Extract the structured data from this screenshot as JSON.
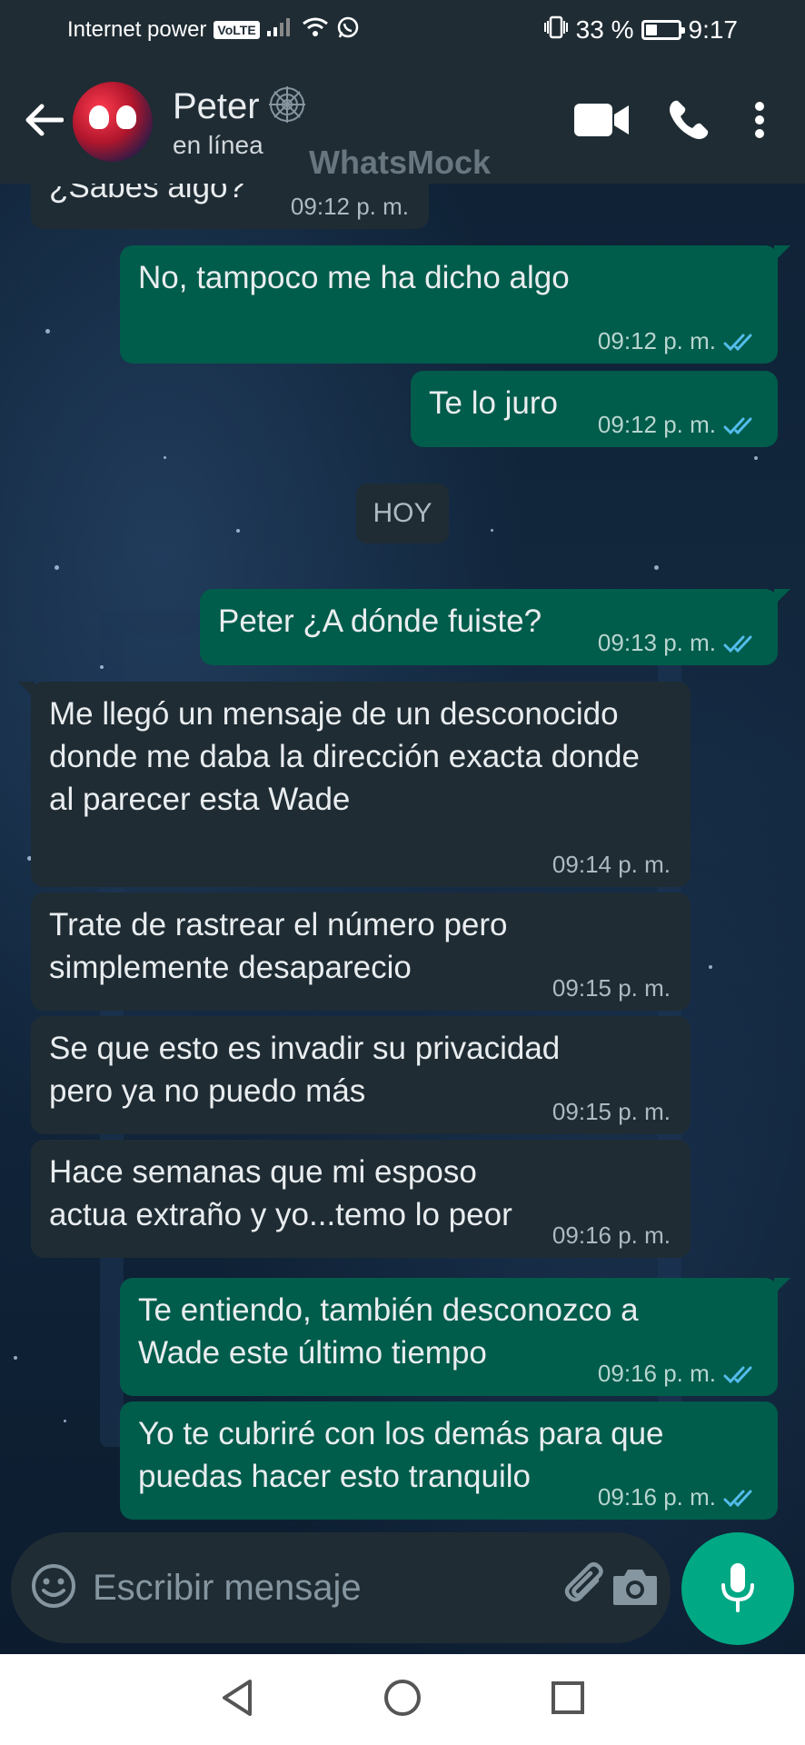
{
  "status_bar": {
    "carrier": "Internet power",
    "volte": "VoLTE",
    "battery": "33 %",
    "time": "9:17"
  },
  "header": {
    "contact_name": "Peter",
    "contact_status": "en línea",
    "watermark": "WhatsMock"
  },
  "date_chip": "HOY",
  "messages": [
    {
      "dir": "in",
      "text": "¿Sabes algo?",
      "time": "09:12 p. m."
    },
    {
      "dir": "out",
      "text": "No, tampoco me ha dicho algo",
      "time": "09:12 p. m."
    },
    {
      "dir": "out",
      "text": "Te lo juro",
      "time": "09:12 p. m."
    },
    {
      "dir": "out",
      "text": "Peter ¿A dónde fuiste?",
      "time": "09:13 p. m."
    },
    {
      "dir": "in",
      "text": "Me llegó un mensaje de un desconocido donde me daba la dirección exacta donde al parecer esta Wade",
      "time": "09:14 p. m."
    },
    {
      "dir": "in",
      "text": "Trate de rastrear el número pero simplemente desaparecio",
      "time": "09:15 p. m."
    },
    {
      "dir": "in",
      "text": "Se que esto es invadir su privacidad pero ya no puedo más",
      "time": "09:15 p. m."
    },
    {
      "dir": "in",
      "text": "Hace semanas que mi esposo actua extraño y yo...temo lo peor",
      "time": "09:16 p. m."
    },
    {
      "dir": "out",
      "text": "Te entiendo, también desconozco a Wade este último tiempo",
      "time": "09:16 p. m."
    },
    {
      "dir": "out",
      "text": "Yo te cubriré con los demás para que puedas hacer esto tranquilo",
      "time": "09:16 p. m."
    }
  ],
  "input": {
    "placeholder": "Escribir mensaje",
    "value": ""
  },
  "colors": {
    "header_bg": "#1f2c34",
    "incoming_bubble": "#1f2c34",
    "outgoing_bubble": "#005c4b",
    "read_ticks": "#53bdeb",
    "mic_button": "#00a884"
  },
  "icons": {
    "back": "arrow-left-icon",
    "verified": "spider-web-icon",
    "video": "video-camera-icon",
    "call": "phone-icon",
    "menu": "more-vertical-icon",
    "emoji": "smiley-icon",
    "attach": "paperclip-icon",
    "camera": "camera-icon",
    "mic": "microphone-icon",
    "nav_back": "triangle-back-icon",
    "nav_home": "circle-home-icon",
    "nav_recent": "square-recent-icon"
  }
}
